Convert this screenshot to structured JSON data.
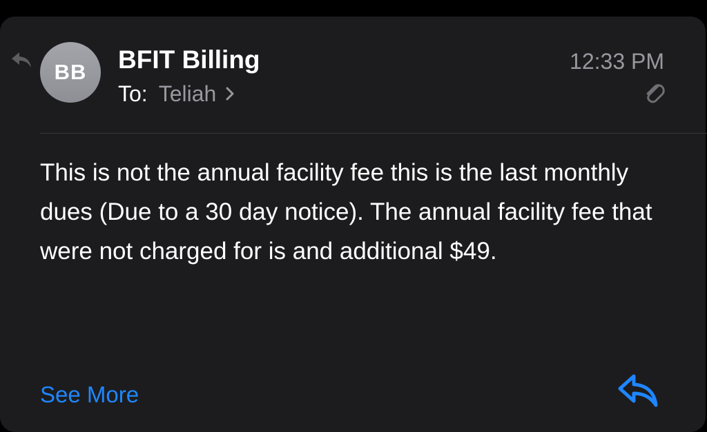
{
  "message": {
    "avatar_initials": "BB",
    "sender": "BFIT Billing",
    "to_label": "To:",
    "recipient": "Teliah",
    "time": "12:33 PM",
    "body": "This is not the annual facility fee this is the last monthly dues (Due to a 30 day notice). The annual facility fee that were not charged for is and additional $49.",
    "see_more_label": "See More"
  },
  "icons": {
    "replied": "replied-arrow-icon",
    "chevron": "chevron-right-icon",
    "attachment": "paperclip-icon",
    "reply": "reply-arrow-icon"
  },
  "colors": {
    "background": "#000000",
    "card": "#1c1c1e",
    "accent": "#1f86ff",
    "secondary_text": "#98989f"
  }
}
